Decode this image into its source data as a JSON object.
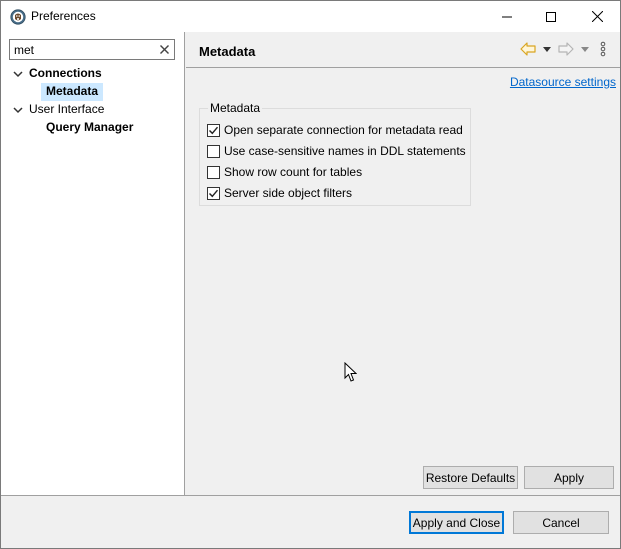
{
  "window": {
    "title": "Preferences",
    "icon": "dbeaver-beaver-icon"
  },
  "filter": {
    "value": "met",
    "clear_icon": "close-icon"
  },
  "tree": {
    "items": [
      {
        "label": "Connections",
        "level": 0,
        "expanded": true,
        "bold": true
      },
      {
        "label": "Metadata",
        "level": 1,
        "selected": true,
        "bold": true
      },
      {
        "label": "User Interface",
        "level": 0,
        "expanded": true,
        "bold": false
      },
      {
        "label": "Query Manager",
        "level": 1,
        "bold": true
      }
    ]
  },
  "page": {
    "title": "Metadata",
    "datasource_link": "Datasource settings",
    "nav_icons": [
      "back-arrow-icon",
      "back-dropdown-icon",
      "forward-arrow-icon",
      "forward-dropdown-icon",
      "more-vertical-icon"
    ]
  },
  "metadata_group": {
    "label": "Metadata",
    "options": [
      {
        "label": "Open separate connection for metadata read",
        "checked": true
      },
      {
        "label": "Use case-sensitive names in DDL statements",
        "checked": false
      },
      {
        "label": "Show row count for tables",
        "checked": false
      },
      {
        "label": "Server side object filters",
        "checked": true
      }
    ]
  },
  "buttons": {
    "restore_defaults": "Restore Defaults",
    "apply": "Apply",
    "apply_and_close": "Apply and Close",
    "cancel": "Cancel"
  },
  "colors": {
    "selection": "#cce8ff",
    "link": "#0066cc",
    "default_button_border": "#0078d7",
    "back_arrow": "#e8b84a"
  }
}
